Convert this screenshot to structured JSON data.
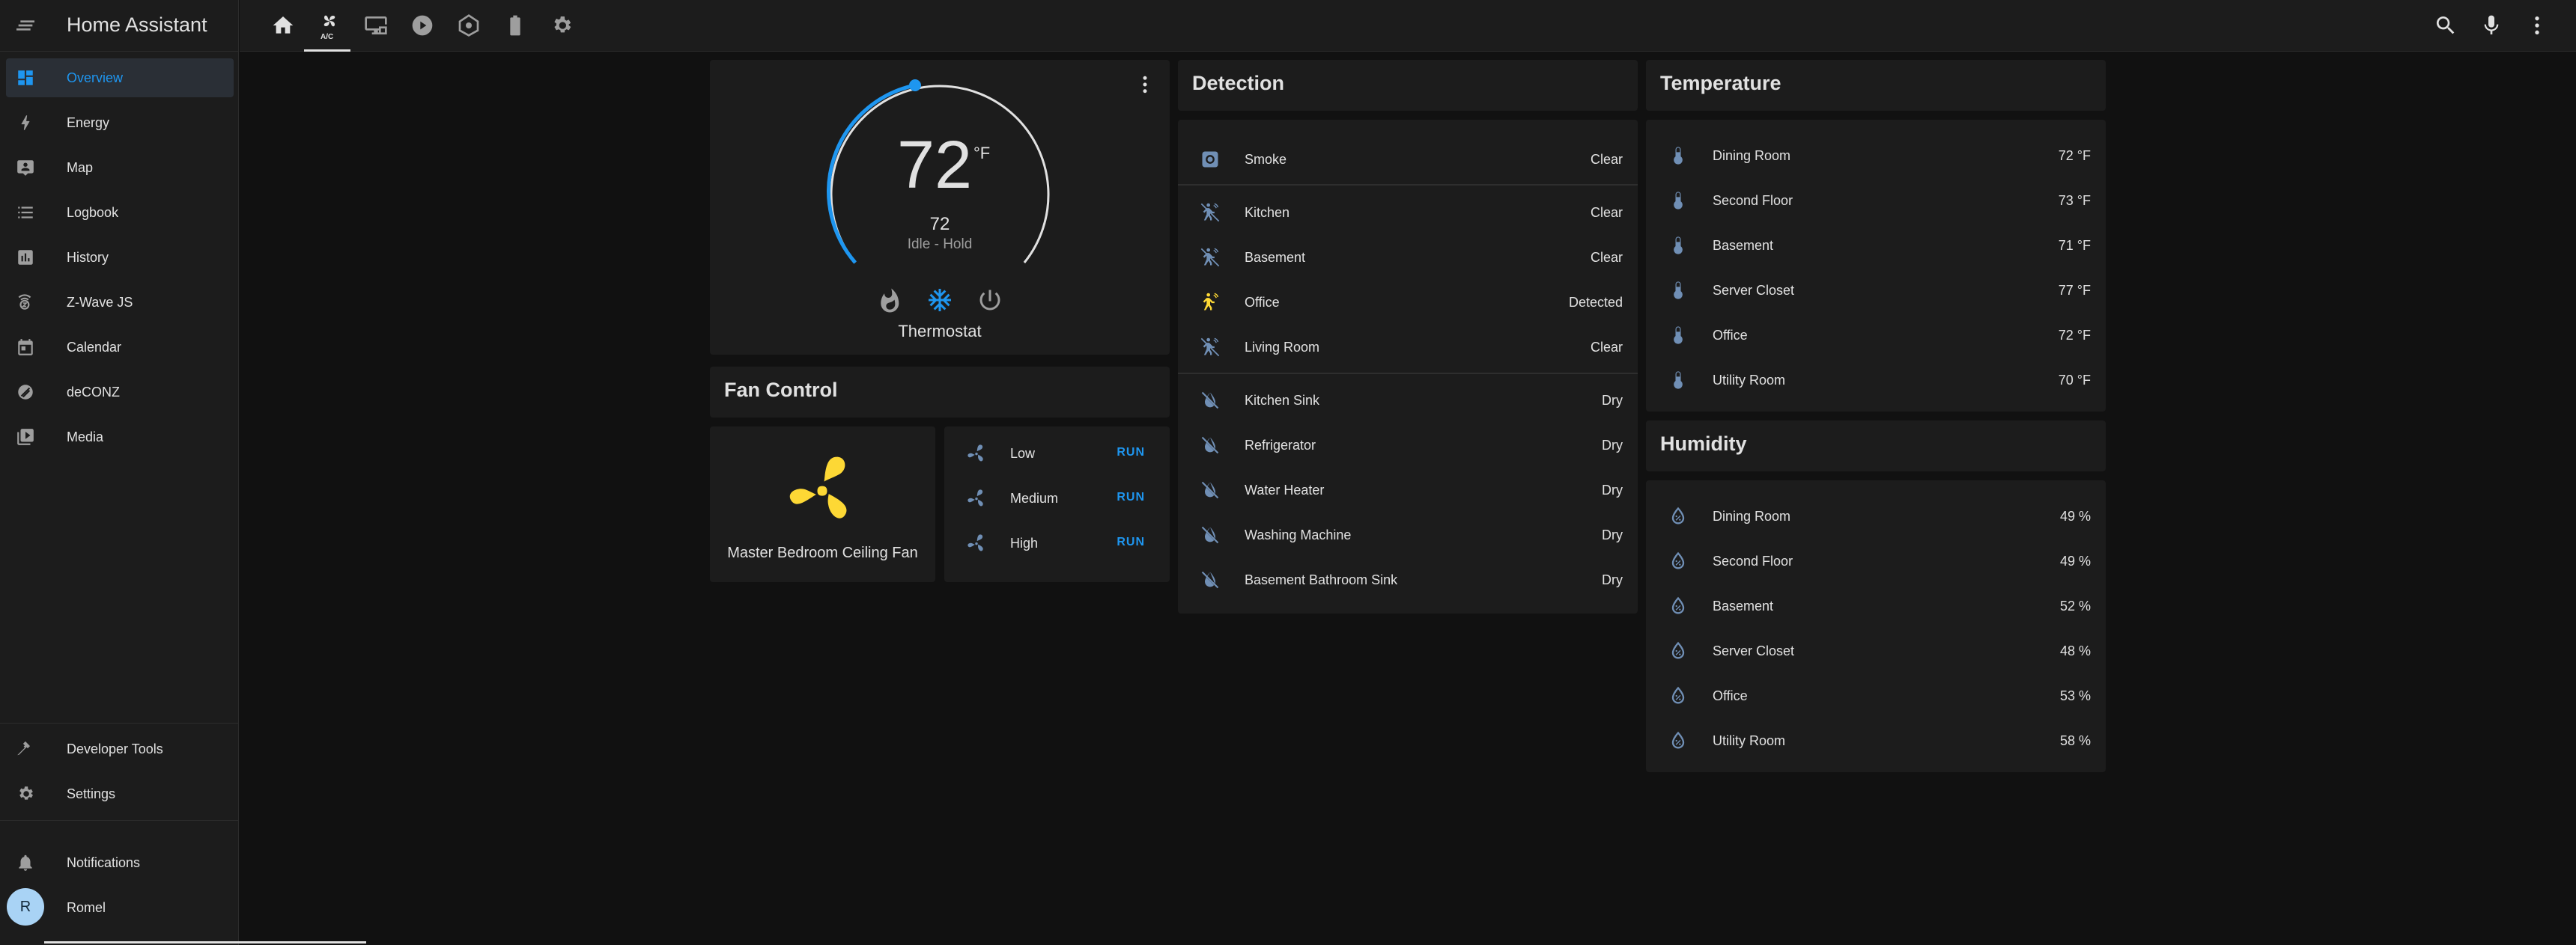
{
  "app": {
    "title": "Home Assistant"
  },
  "sidebar": {
    "items": [
      {
        "label": "Overview",
        "icon": "dashboard-icon"
      },
      {
        "label": "Energy",
        "icon": "lightning-icon"
      },
      {
        "label": "Map",
        "icon": "map-icon"
      },
      {
        "label": "Logbook",
        "icon": "logbook-icon"
      },
      {
        "label": "History",
        "icon": "history-icon"
      },
      {
        "label": "Z-Wave JS",
        "icon": "zwave-icon"
      },
      {
        "label": "Calendar",
        "icon": "calendar-icon"
      },
      {
        "label": "deCONZ",
        "icon": "deconz-icon"
      },
      {
        "label": "Media",
        "icon": "media-icon"
      }
    ],
    "bottom_items": [
      {
        "label": "Developer Tools",
        "icon": "hammer-icon"
      },
      {
        "label": "Settings",
        "icon": "gear-icon"
      },
      {
        "label": "Notifications",
        "icon": "bell-icon"
      }
    ],
    "user": {
      "name": "Romel",
      "initial": "R"
    }
  },
  "topbar": {
    "tabs": [
      "home-icon",
      "fan-ac-icon",
      "monitor-icon",
      "play-icon",
      "robot-vacuum-icon",
      "battery-icon",
      "gear-icon"
    ],
    "active_tab_index": 1,
    "tab_badge": "A/C",
    "actions": [
      "search-icon",
      "microphone-icon",
      "more-vert-icon"
    ]
  },
  "thermostat": {
    "temperature": "72",
    "unit": "°F",
    "target": "72",
    "status": "Idle - Hold",
    "name": "Thermostat",
    "modes": [
      "heat-icon",
      "cool-icon",
      "power-icon"
    ],
    "active_mode": "cool"
  },
  "fan_control": {
    "title": "Fan Control",
    "fan_name": "Master Bedroom Ceiling Fan",
    "speeds": [
      {
        "label": "Low",
        "action": "RUN"
      },
      {
        "label": "Medium",
        "action": "RUN"
      },
      {
        "label": "High",
        "action": "RUN"
      }
    ]
  },
  "detection": {
    "title": "Detection",
    "smoke": {
      "name": "Smoke",
      "state": "Clear"
    },
    "motion": [
      {
        "name": "Kitchen",
        "state": "Clear"
      },
      {
        "name": "Basement",
        "state": "Clear"
      },
      {
        "name": "Office",
        "state": "Detected"
      },
      {
        "name": "Living Room",
        "state": "Clear"
      }
    ],
    "leak": [
      {
        "name": "Kitchen Sink",
        "state": "Dry"
      },
      {
        "name": "Refrigerator",
        "state": "Dry"
      },
      {
        "name": "Water Heater",
        "state": "Dry"
      },
      {
        "name": "Washing Machine",
        "state": "Dry"
      },
      {
        "name": "Basement Bathroom Sink",
        "state": "Dry"
      }
    ]
  },
  "temperature": {
    "title": "Temperature",
    "rows": [
      {
        "name": "Dining Room",
        "value": "72 °F"
      },
      {
        "name": "Second Floor",
        "value": "73 °F"
      },
      {
        "name": "Basement",
        "value": "71 °F"
      },
      {
        "name": "Server Closet",
        "value": "77 °F"
      },
      {
        "name": "Office",
        "value": "72 °F"
      },
      {
        "name": "Utility Room",
        "value": "70 °F"
      }
    ]
  },
  "humidity": {
    "title": "Humidity",
    "rows": [
      {
        "name": "Dining Room",
        "value": "49 %"
      },
      {
        "name": "Second Floor",
        "value": "49 %"
      },
      {
        "name": "Basement",
        "value": "52 %"
      },
      {
        "name": "Server Closet",
        "value": "48 %"
      },
      {
        "name": "Office",
        "value": "53 %"
      },
      {
        "name": "Utility Room",
        "value": "58 %"
      }
    ]
  },
  "colors": {
    "accent": "#1e96f0",
    "active_motion": "#fdd835",
    "fan_on": "#fdd835",
    "background": "#111111",
    "card": "#1c1c1c"
  }
}
